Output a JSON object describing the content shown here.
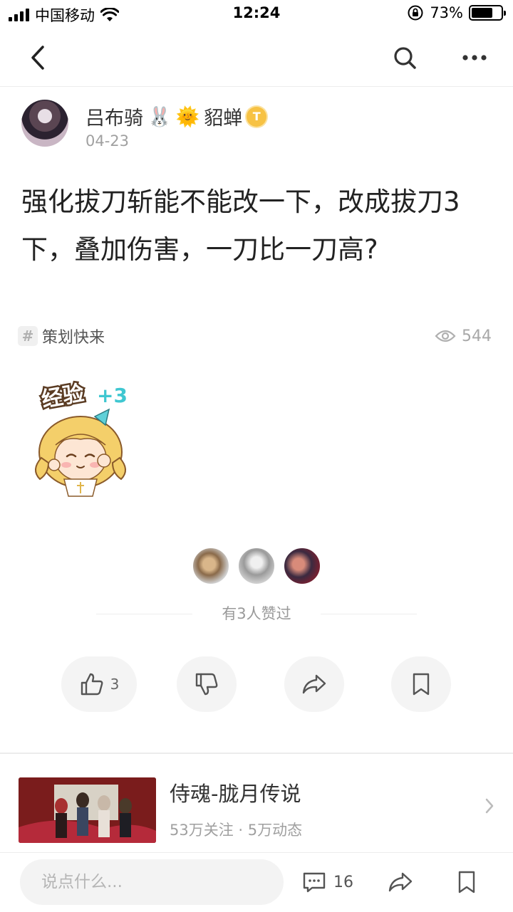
{
  "status_bar": {
    "carrier": "中国移动",
    "time": "12:24",
    "battery": "73%",
    "battery_level": 0.73,
    "icons": [
      "signal-icon",
      "wifi-icon",
      "rotation-lock-icon",
      "battery-icon"
    ]
  },
  "nav": {
    "icons": [
      "back-arrow-icon",
      "search-icon",
      "more-dots-icon"
    ]
  },
  "author": {
    "name": "吕布骑",
    "name_suffix": "貂蝉",
    "name_emojis": [
      "🐰",
      "🌞"
    ],
    "badge": "T",
    "date": "04-23"
  },
  "post": {
    "title": "强化拔刀斩能不能改一下，改成拔刀3下，叠加伤害，一刀比一刀高?",
    "topic_hash": "#",
    "topic": "策划快来",
    "views": "544",
    "sticker_text": "经验",
    "sticker_bonus": "+3"
  },
  "likes": {
    "caption": "有3人赞过",
    "avatar_count": 3
  },
  "actions": {
    "like_count": "3",
    "icons": [
      "thumbs-up-icon",
      "thumbs-down-icon",
      "share-icon",
      "bookmark-icon"
    ]
  },
  "game": {
    "name": "侍魂-胧月传说",
    "meta": "53万关注 · 5万动态"
  },
  "bottom_bar": {
    "placeholder": "说点什么...",
    "comment_count": "16"
  },
  "colors": {
    "text": "#222222",
    "muted": "#a0a0a0",
    "action_bg": "#f4f4f4",
    "badge": "#f7c244"
  }
}
